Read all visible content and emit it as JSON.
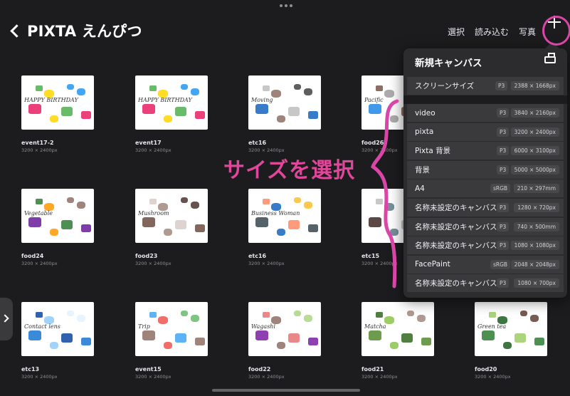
{
  "header": {
    "back_label": "PIXTA えんぴつ",
    "actions": [
      "選択",
      "読み込む",
      "写真"
    ]
  },
  "tiles": [
    {
      "name": "event17-2",
      "dims": "3200 × 2400px",
      "art": "birthday"
    },
    {
      "name": "event17",
      "dims": "3200 × 2400px",
      "art": "birthday"
    },
    {
      "name": "etc16",
      "dims": "3200 × 2400px",
      "art": "moving"
    },
    {
      "name": "food26",
      "dims": "3200 × 2400px",
      "art": "fish"
    },
    {
      "name": "food24",
      "dims": "3200 × 2400px",
      "art": "vegetable"
    },
    {
      "name": "food23",
      "dims": "3200 × 2400px",
      "art": "mushroom"
    },
    {
      "name": "etc16",
      "dims": "3200 × 2400px",
      "art": "business"
    },
    {
      "name": "etc15",
      "dims": "3200 × 2400px",
      "art": "bag"
    },
    {
      "name": "etc13",
      "dims": "3200 × 2400px",
      "art": "contact"
    },
    {
      "name": "event15",
      "dims": "3200 × 2400px",
      "art": "trip"
    },
    {
      "name": "food22",
      "dims": "3200 × 2400px",
      "art": "wagashi"
    },
    {
      "name": "food21",
      "dims": "3200 × 2400px",
      "art": "matcha"
    },
    {
      "name": "food20",
      "dims": "3200 × 2400px",
      "art": "greentea"
    }
  ],
  "thumb_text": {
    "birthday": "HAPPY BIRTHDAY",
    "moving": "Moving",
    "fish": "Pacific",
    "vegetable": "Vegetable",
    "mushroom": "Mushroom",
    "business": "Business Woman",
    "contact": "Contact lens",
    "trip": "Trip",
    "wagashi": "Wagashi",
    "matcha": "Matcha",
    "greentea": "Green tea"
  },
  "panel": {
    "title": "新規キャンバス",
    "screen_row": {
      "name": "スクリーンサイズ",
      "color_space": "P3",
      "size": "2388 × 1668px"
    },
    "presets": [
      {
        "name": "video",
        "color_space": "P3",
        "size": "3840 × 2160px"
      },
      {
        "name": "pixta",
        "color_space": "P3",
        "size": "3200 × 2400px"
      },
      {
        "name": "Pixta 背景",
        "color_space": "P3",
        "size": "6000 × 3100px"
      },
      {
        "name": "背景",
        "color_space": "P3",
        "size": "5000 × 5000px"
      },
      {
        "name": "A4",
        "color_space": "sRGB",
        "size": "210 × 297mm"
      },
      {
        "name": "名称未設定のキャンバス",
        "color_space": "P3",
        "size": "1280 × 720px"
      },
      {
        "name": "名称未設定のキャンバス",
        "color_space": "P3",
        "size": "740 × 500mm"
      },
      {
        "name": "名称未設定のキャンバス",
        "color_space": "P3",
        "size": "1080 × 1080px"
      },
      {
        "name": "FacePaint",
        "color_space": "sRGB",
        "size": "2048 × 2048px"
      },
      {
        "name": "名称未設定のキャンバス",
        "color_space": "P3",
        "size": "1080 × 700px"
      }
    ]
  },
  "annotation": {
    "text": "サイズを選択",
    "color": "#e0479a"
  },
  "colors": {
    "background": "#1c1c1e",
    "panel": "#2c2c2e",
    "row": "#3a3a3c",
    "annotation": "#d946a8"
  }
}
